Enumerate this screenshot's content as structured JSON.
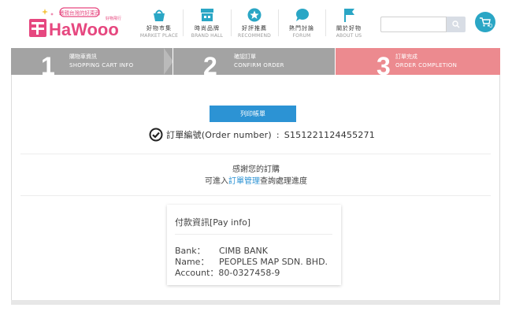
{
  "header": {
    "logo_text": "HaWooo",
    "logo_badge": "最親台灣的好東西",
    "logo_sub": "好物飛行",
    "nav": [
      {
        "zh": "好物市集",
        "en": "MARKET PLACE",
        "icon": "shopping-basket-icon"
      },
      {
        "zh": "時尚品牌",
        "en": "BRAND HALL",
        "icon": "store-icon"
      },
      {
        "zh": "好評推薦",
        "en": "RECOMMEND",
        "icon": "star-badge-icon"
      },
      {
        "zh": "熱門討論",
        "en": "FORUM",
        "icon": "chat-bubble-icon"
      },
      {
        "zh": "關於好物",
        "en": "ABOUT US",
        "icon": "flag-icon"
      }
    ],
    "search_placeholder": "",
    "cart_count": "0"
  },
  "steps": [
    {
      "num": "1",
      "zh": "購物車資訊",
      "en": "SHOPPING CART INFO",
      "color": "#a3a3a3"
    },
    {
      "num": "2",
      "zh": "確認訂單",
      "en": "CONFIRM ORDER",
      "color": "#a3a3a3"
    },
    {
      "num": "3",
      "zh": "訂單完成",
      "en": "ORDER COMPLETION",
      "color": "#ec8a8f"
    }
  ],
  "order": {
    "print_label": "列印帳單",
    "number_label": "訂單編號(Order number)",
    "number_value": "S151221124455271"
  },
  "thanks": {
    "line1": "感謝您的訂購",
    "line2_prefix": "可進入",
    "line2_link": "訂單管理",
    "line2_suffix": "查詢處理進度"
  },
  "pay": {
    "title": "付款資訊[Pay info]",
    "bank_label": "Bank：",
    "bank_value": "CIMB BANK",
    "name_label": "Name：",
    "name_value": "PEOPLES MAP SDN. BHD.",
    "account_label": "Account：",
    "account_value": "80-0327458-9"
  },
  "colors": {
    "accent": "#2c93d4",
    "brand_pink": "#e6477f",
    "cart": "#2aa6c5",
    "step_done": "#a3a3a3",
    "step_active": "#ec8a8f"
  }
}
